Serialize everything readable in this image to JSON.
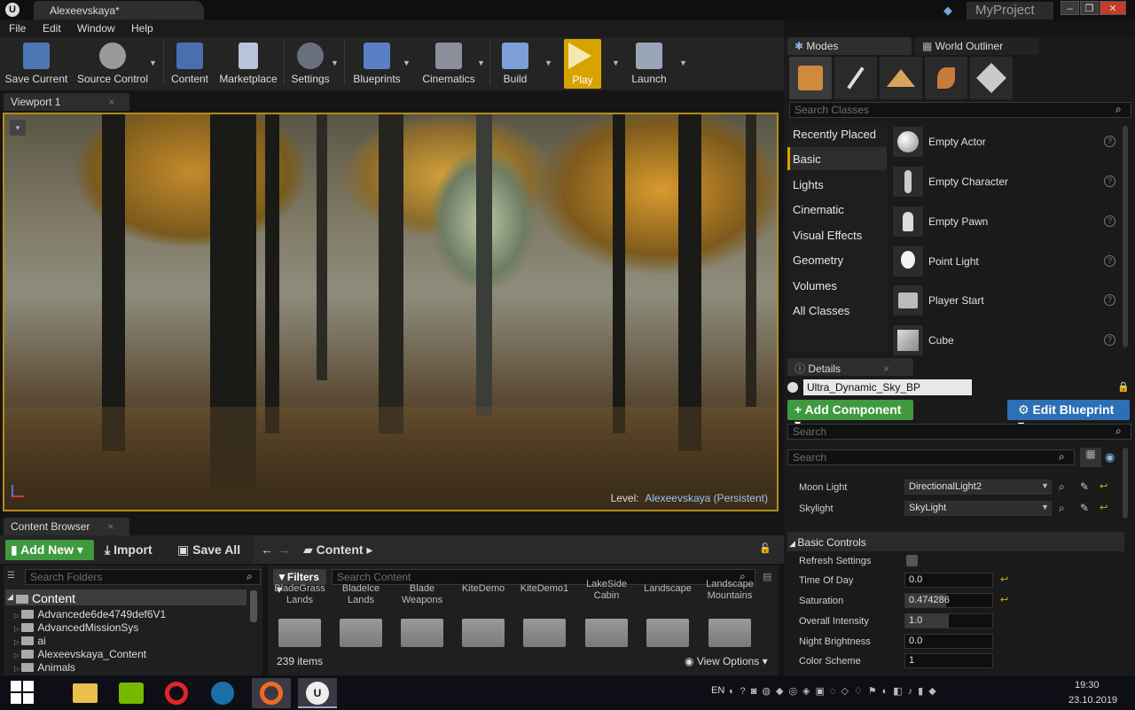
{
  "window": {
    "tab_title": "Alexeevskaya*",
    "project_name": "MyProject"
  },
  "menu": [
    "File",
    "Edit",
    "Window",
    "Help"
  ],
  "toolbar": {
    "save_current": "Save Current",
    "source_control": "Source Control",
    "content": "Content",
    "marketplace": "Marketplace",
    "settings": "Settings",
    "blueprints": "Blueprints",
    "cinematics": "Cinematics",
    "build": "Build",
    "play": "Play",
    "launch": "Launch"
  },
  "viewport": {
    "tab": "Viewport 1",
    "level_label": "Level:",
    "level_name": "Alexeevskaya (Persistent)"
  },
  "content_browser": {
    "tab": "Content Browser",
    "add_new": "Add New",
    "import": "Import",
    "save_all": "Save All",
    "path_root": "Content",
    "search_folders_placeholder": "Search Folders",
    "filters": "Filters",
    "search_content_placeholder": "Search Content",
    "tree_root": "Content",
    "tree_items": [
      "Advancede6de4749def6V1",
      "AdvancedMissionSys",
      "ai",
      "Alexeevskaya_Content",
      "Animals"
    ],
    "assets": [
      [
        "BladeGrass",
        "Lands"
      ],
      [
        "Bladelce",
        "Lands"
      ],
      [
        "Blade",
        "Weapons"
      ],
      [
        "KiteDemo",
        ""
      ],
      [
        "KiteDemo1",
        ""
      ],
      [
        "LakeSide",
        "Cabin"
      ],
      [
        "Landscape",
        ""
      ],
      [
        "Landscape",
        "Mountains"
      ]
    ],
    "item_count": "239 items",
    "view_options": "View Options"
  },
  "modes": {
    "tab": "Modes",
    "outliner_tab": "World Outliner",
    "search_placeholder": "Search Classes",
    "categories": [
      "Recently Placed",
      "Basic",
      "Lights",
      "Cinematic",
      "Visual Effects",
      "Geometry",
      "Volumes",
      "All Classes"
    ],
    "selected_category": "Basic",
    "items": [
      "Empty Actor",
      "Empty Character",
      "Empty Pawn",
      "Point Light",
      "Player Start",
      "Cube"
    ]
  },
  "details": {
    "tab": "Details",
    "actor_name": "Ultra_Dynamic_Sky_BP",
    "add_component": "Add Component",
    "edit_blueprint": "Edit Blueprint",
    "search_placeholder": "Search",
    "search2_placeholder": "Search",
    "moon_light_label": "Moon Light",
    "moon_light_value": "DirectionalLight2",
    "skylight_label": "Skylight",
    "skylight_value": "SkyLight",
    "section": "Basic Controls",
    "refresh_label": "Refresh Settings",
    "props": [
      {
        "label": "Time Of Day",
        "value": "0.0"
      },
      {
        "label": "Saturation",
        "value": "0.474286"
      },
      {
        "label": "Overall Intensity",
        "value": "1.0"
      },
      {
        "label": "Night Brightness",
        "value": "0.0"
      },
      {
        "label": "Color Scheme",
        "value": "1"
      }
    ]
  },
  "taskbar": {
    "lang": "EN",
    "time": "19:30",
    "date": "23.10.2019"
  }
}
